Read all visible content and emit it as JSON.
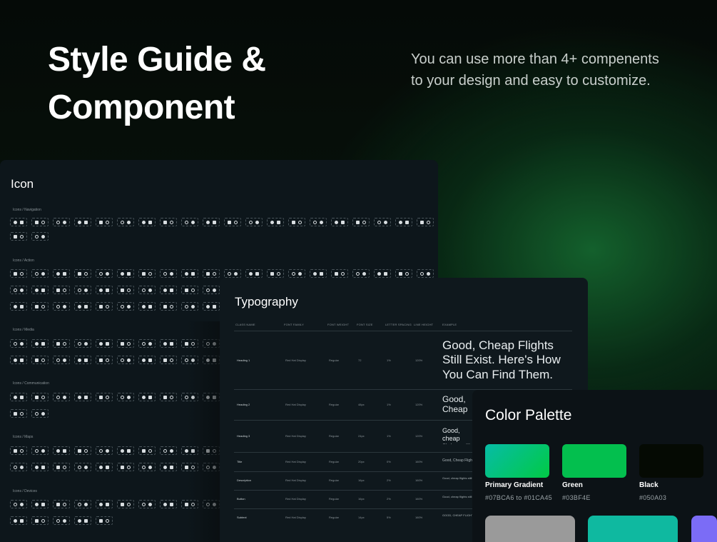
{
  "hero": {
    "title_line1": "Style Guide &",
    "title_line2": "Component",
    "description": "You can use more than 4+ compenents to your design and easy to customize."
  },
  "icon_card": {
    "title": "Icon",
    "sections": [
      {
        "label": "Icons / Navigation"
      },
      {
        "label": "Icons / Action"
      },
      {
        "label": "Icons / Media"
      },
      {
        "label": "Icons / Communication"
      },
      {
        "label": "Icons / Maps"
      },
      {
        "label": "Icons / Devices"
      }
    ]
  },
  "typography_card": {
    "title": "Typography",
    "headers": [
      "CLASS NAME",
      "FONT FAMILY",
      "FONT WEIGHT",
      "FONT SIZE",
      "LETTER SPACING",
      "LINE HEIGHT",
      "EXAMPLE"
    ],
    "rows": [
      {
        "name": "Heading 1",
        "family": "Red Hat Display",
        "weight": "Regular",
        "size": "72",
        "spacing": "1%",
        "line": "120%",
        "example": "Good, Cheap Flights Still Exist. Here's How You Can Find Them."
      },
      {
        "name": "Heading 2",
        "family": "Red Hat Display",
        "weight": "Regular",
        "size": "48px",
        "spacing": "1%",
        "line": "120%",
        "example": "Good, Cheap Flights Still Exist. Here's How You Can Find Them."
      },
      {
        "name": "Heading 3",
        "family": "Red Hat Display",
        "weight": "Regular",
        "size": "24px",
        "spacing": "1%",
        "line": "120%",
        "example": "Good, cheap flights still exist. Here's how you can find them."
      },
      {
        "name": "Title",
        "family": "Red Hat Display",
        "weight": "Regular",
        "size": "20px",
        "spacing": "0%",
        "line": "160%",
        "example": "Good, Cheap Flights Still Exist. Here's How You Can Find Them."
      },
      {
        "name": "Description",
        "family": "Red Hat Display",
        "weight": "Regular",
        "size": "16px",
        "spacing": "2%",
        "line": "160%",
        "example": "Good, cheap flights still exist. Here's how you can find them."
      },
      {
        "name": "Button",
        "family": "Red Hat Display",
        "weight": "Regular",
        "size": "16px",
        "spacing": "2%",
        "line": "160%",
        "example": "Good, cheap flights still exist. Here's how you can find them."
      },
      {
        "name": "Subtext",
        "family": "Red Hat Display",
        "weight": "Regular",
        "size": "14px",
        "spacing": "5%",
        "line": "160%",
        "example": "GOOD, CHEAP FLIGHTS STILL EXIST."
      }
    ]
  },
  "color_card": {
    "title": "Color Palette",
    "swatches": [
      {
        "name": "Primary Gradient",
        "code": "#07BCA6 to #01CA45",
        "from": "#07BCA6",
        "to": "#01CA45"
      },
      {
        "name": "Green",
        "code": "#03BF4E",
        "color": "#03BF4E"
      },
      {
        "name": "Black",
        "code": "#050A03",
        "color": "#050A03"
      }
    ],
    "extra_colors": [
      "#9A9A9A",
      "#0FB9A0",
      "#7B6CF6"
    ]
  }
}
